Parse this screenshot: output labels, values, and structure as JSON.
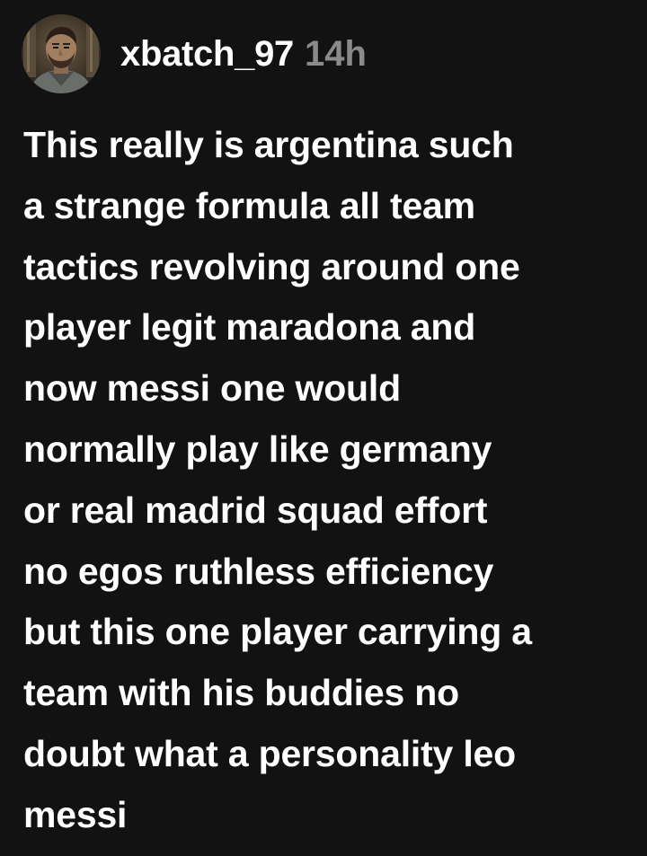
{
  "comment": {
    "author": {
      "username": "xbatch_97",
      "avatar_icon": "user-avatar"
    },
    "timestamp": "14h",
    "body_lines": [
      "This really is argentina such",
      "a strange formula all team",
      "tactics revolving around one",
      "player legit maradona and",
      "now messi one would",
      "normally play like germany",
      "or real madrid squad effort",
      "no egos ruthless efficiency",
      "but this one player carrying a",
      "team with his buddies no",
      "doubt what a personality leo",
      "messi"
    ]
  },
  "colors": {
    "background": "#121212",
    "text": "#ffffff",
    "timestamp": "#8a8a8a"
  }
}
